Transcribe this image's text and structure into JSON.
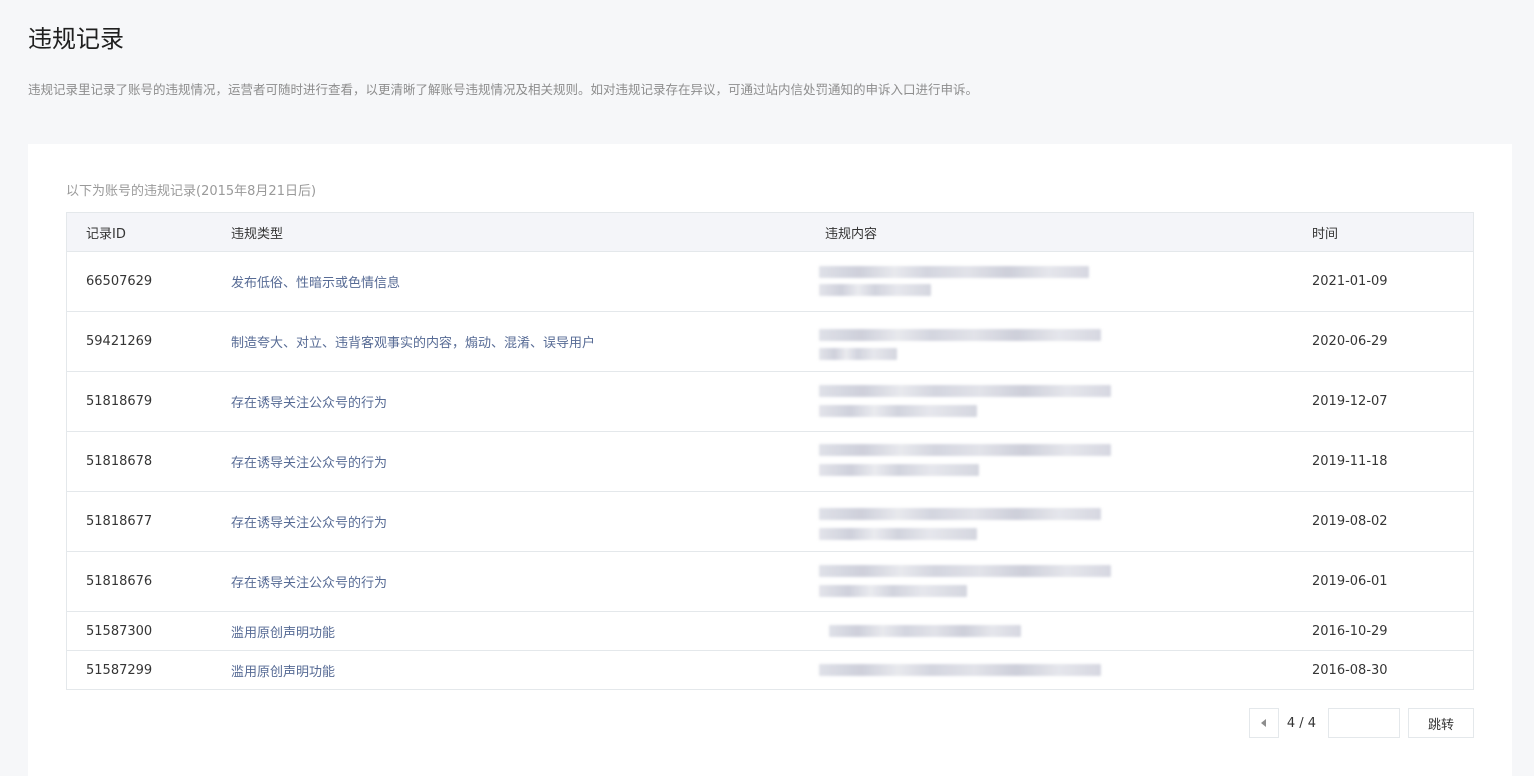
{
  "page": {
    "title": "违规记录",
    "description": "违规记录里记录了账号的违规情况，运营者可随时进行查看，以更清晰了解账号违规情况及相关规则。如对违规记录存在异议，可通过站内信处罚通知的申诉入口进行申诉。"
  },
  "table": {
    "caption": "以下为账号的违规记录(2015年8月21日后)",
    "headers": {
      "id": "记录ID",
      "type": "违规类型",
      "content": "违规内容",
      "time": "时间"
    },
    "rows": [
      {
        "id": "66507629",
        "type": "发布低俗、性暗示或色情信息",
        "time": "2021-01-09"
      },
      {
        "id": "59421269",
        "type": "制造夸大、对立、违背客观事实的内容，煽动、混淆、误导用户",
        "time": "2020-06-29"
      },
      {
        "id": "51818679",
        "type": "存在诱导关注公众号的行为",
        "time": "2019-12-07"
      },
      {
        "id": "51818678",
        "type": "存在诱导关注公众号的行为",
        "time": "2019-11-18"
      },
      {
        "id": "51818677",
        "type": "存在诱导关注公众号的行为",
        "time": "2019-08-02"
      },
      {
        "id": "51818676",
        "type": "存在诱导关注公众号的行为",
        "time": "2019-06-01"
      },
      {
        "id": "51587300",
        "type": "滥用原创声明功能",
        "time": "2016-10-29"
      },
      {
        "id": "51587299",
        "type": "滥用原创声明功能",
        "time": "2016-08-30"
      }
    ]
  },
  "pagination": {
    "count": "4 / 4",
    "input_value": "",
    "jump_label": "跳转",
    "prev_icon": "caret-left-icon"
  },
  "colors": {
    "link": "#576b95",
    "page_bg": "#f6f7f9",
    "header_bg": "#f4f5f9",
    "border": "#e4e8eb"
  }
}
